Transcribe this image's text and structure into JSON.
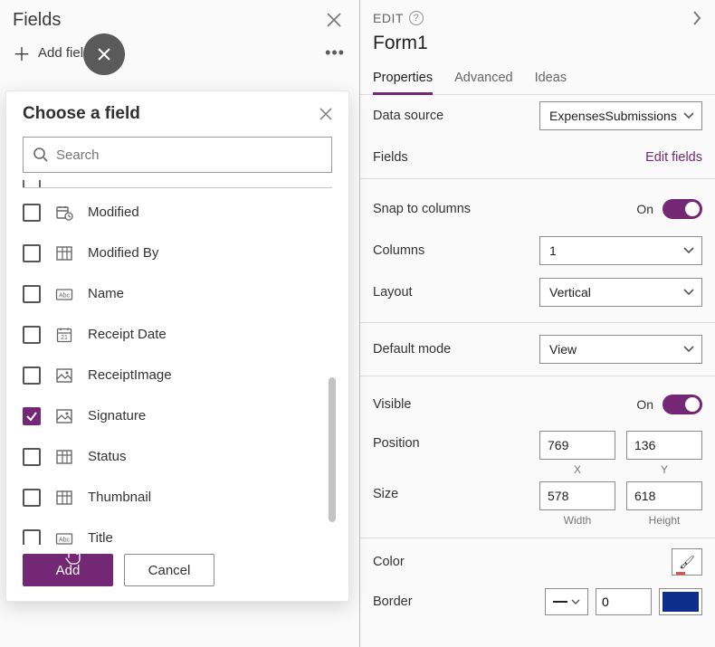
{
  "left": {
    "title": "Fields",
    "add_field": "Add field",
    "popup": {
      "title": "Choose a field",
      "search_placeholder": "Search",
      "fields": [
        {
          "label": "Modified",
          "type": "datetime",
          "checked": false
        },
        {
          "label": "Modified By",
          "type": "lookup",
          "checked": false
        },
        {
          "label": "Name",
          "type": "text",
          "checked": false
        },
        {
          "label": "Receipt Date",
          "type": "date",
          "checked": false
        },
        {
          "label": "ReceiptImage",
          "type": "image",
          "checked": false
        },
        {
          "label": "Signature",
          "type": "image",
          "checked": true
        },
        {
          "label": "Status",
          "type": "lookup",
          "checked": false
        },
        {
          "label": "Thumbnail",
          "type": "lookup",
          "checked": false
        },
        {
          "label": "Title",
          "type": "text",
          "checked": false
        }
      ],
      "add": "Add",
      "cancel": "Cancel"
    }
  },
  "right": {
    "edit_label": "EDIT",
    "form_name": "Form1",
    "tabs": {
      "properties": "Properties",
      "advanced": "Advanced",
      "ideas": "Ideas"
    },
    "props": {
      "data_source_label": "Data source",
      "data_source_value": "ExpensesSubmissions",
      "fields_label": "Fields",
      "edit_fields": "Edit fields",
      "snap_label": "Snap to columns",
      "snap_state": "On",
      "columns_label": "Columns",
      "columns_value": "1",
      "layout_label": "Layout",
      "layout_value": "Vertical",
      "default_mode_label": "Default mode",
      "default_mode_value": "View",
      "visible_label": "Visible",
      "visible_state": "On",
      "position_label": "Position",
      "pos_x": "769",
      "pos_y": "136",
      "pos_x_sub": "X",
      "pos_y_sub": "Y",
      "size_label": "Size",
      "size_w": "578",
      "size_h": "618",
      "size_w_sub": "Width",
      "size_h_sub": "Height",
      "color_label": "Color",
      "border_label": "Border",
      "border_value": "0",
      "border_color": "#0d2e8a"
    }
  }
}
